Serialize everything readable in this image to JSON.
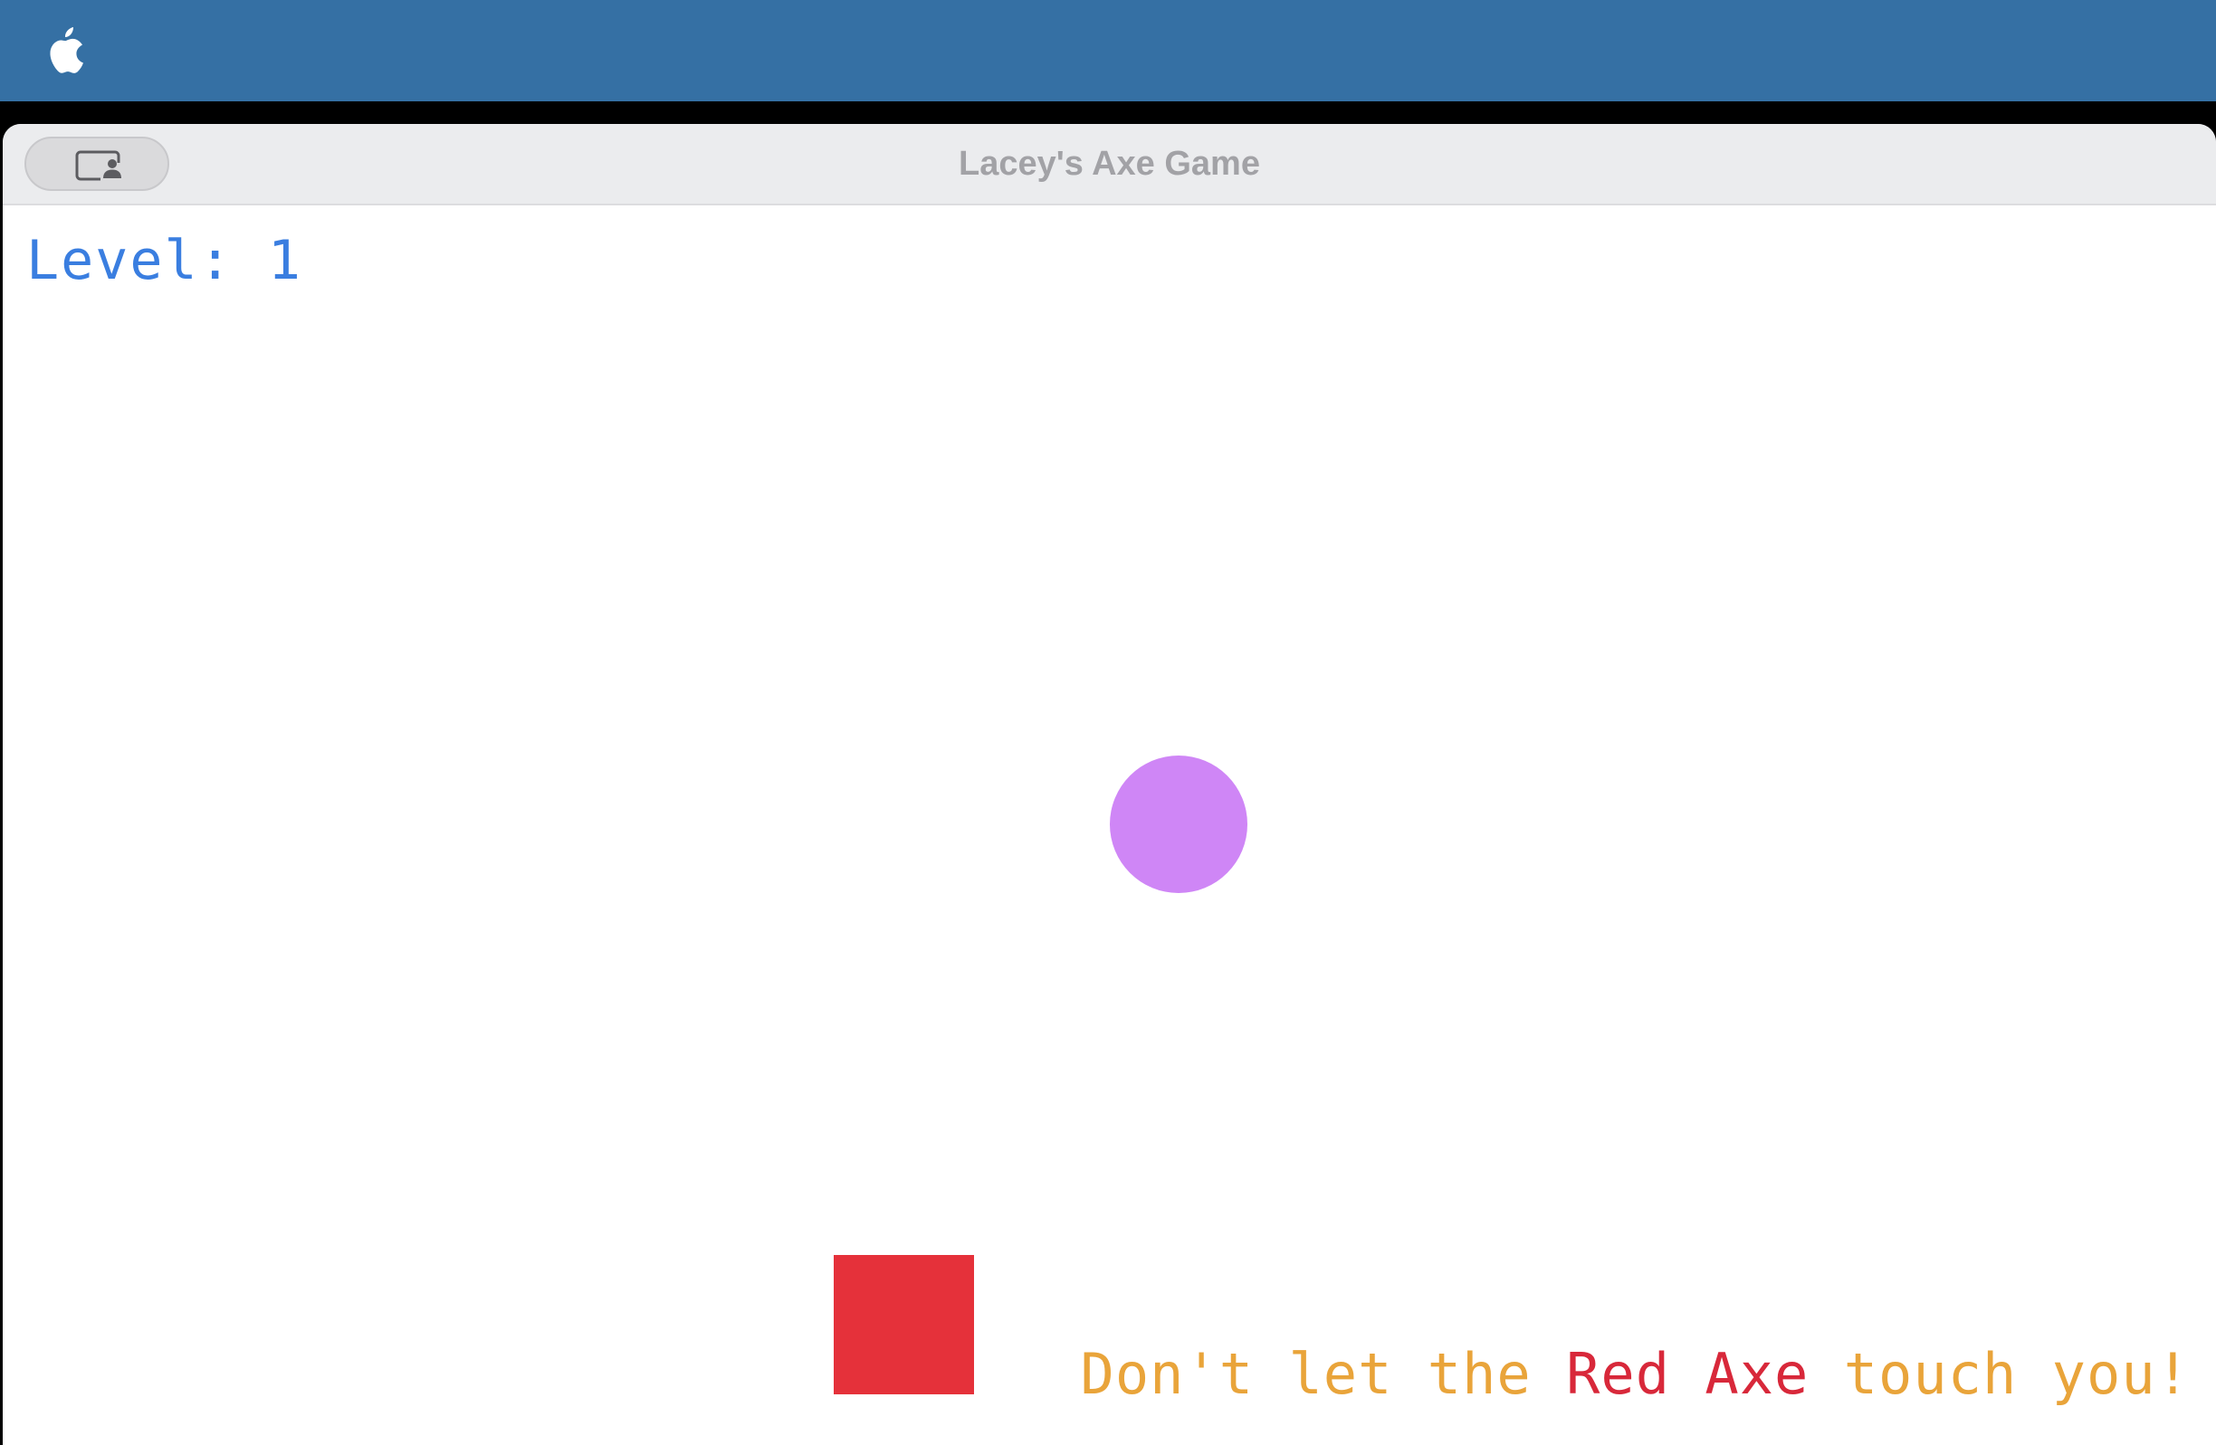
{
  "menubar": {
    "apple_icon": "apple-icon",
    "color": "#3570a4"
  },
  "window": {
    "title": "Lacey's Axe Game",
    "sidebar_toggle_icon": "sidebar-person-icon"
  },
  "game": {
    "level_label": "Level: 1",
    "warning": {
      "part1": "Don't let the ",
      "highlight": "Red Axe",
      "part2": " touch you!"
    },
    "colors": {
      "level_text": "#3a7ee0",
      "warning_text": "#e9a43a",
      "warning_highlight": "#d8283a",
      "player": "#cf86f6",
      "axe": "#e5313a"
    }
  }
}
